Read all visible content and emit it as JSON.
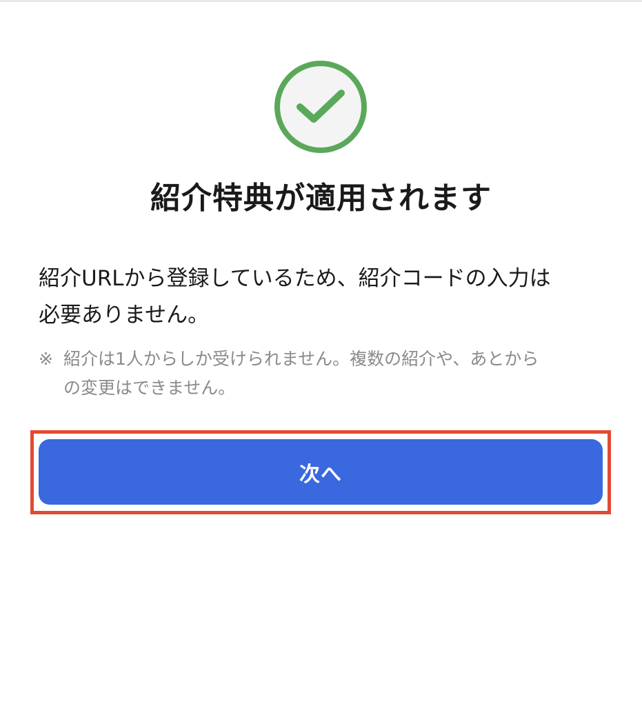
{
  "icons": {
    "success": "check-circle-icon"
  },
  "colors": {
    "success_green": "#5aa85a",
    "primary_blue": "#3a68de",
    "highlight_red": "#e24a33",
    "note_gray": "#8a8a8a"
  },
  "main": {
    "title": "紹介特典が適用されます",
    "description_line1": "紹介URLから登録しているため、紹介コードの入力は",
    "description_line2": "必要ありません。",
    "note_mark": "※",
    "note_line1": "紹介は1人からしか受けられません。複数の紹介や、あとから",
    "note_line2": "の変更はできません。",
    "next_button_label": "次へ"
  }
}
